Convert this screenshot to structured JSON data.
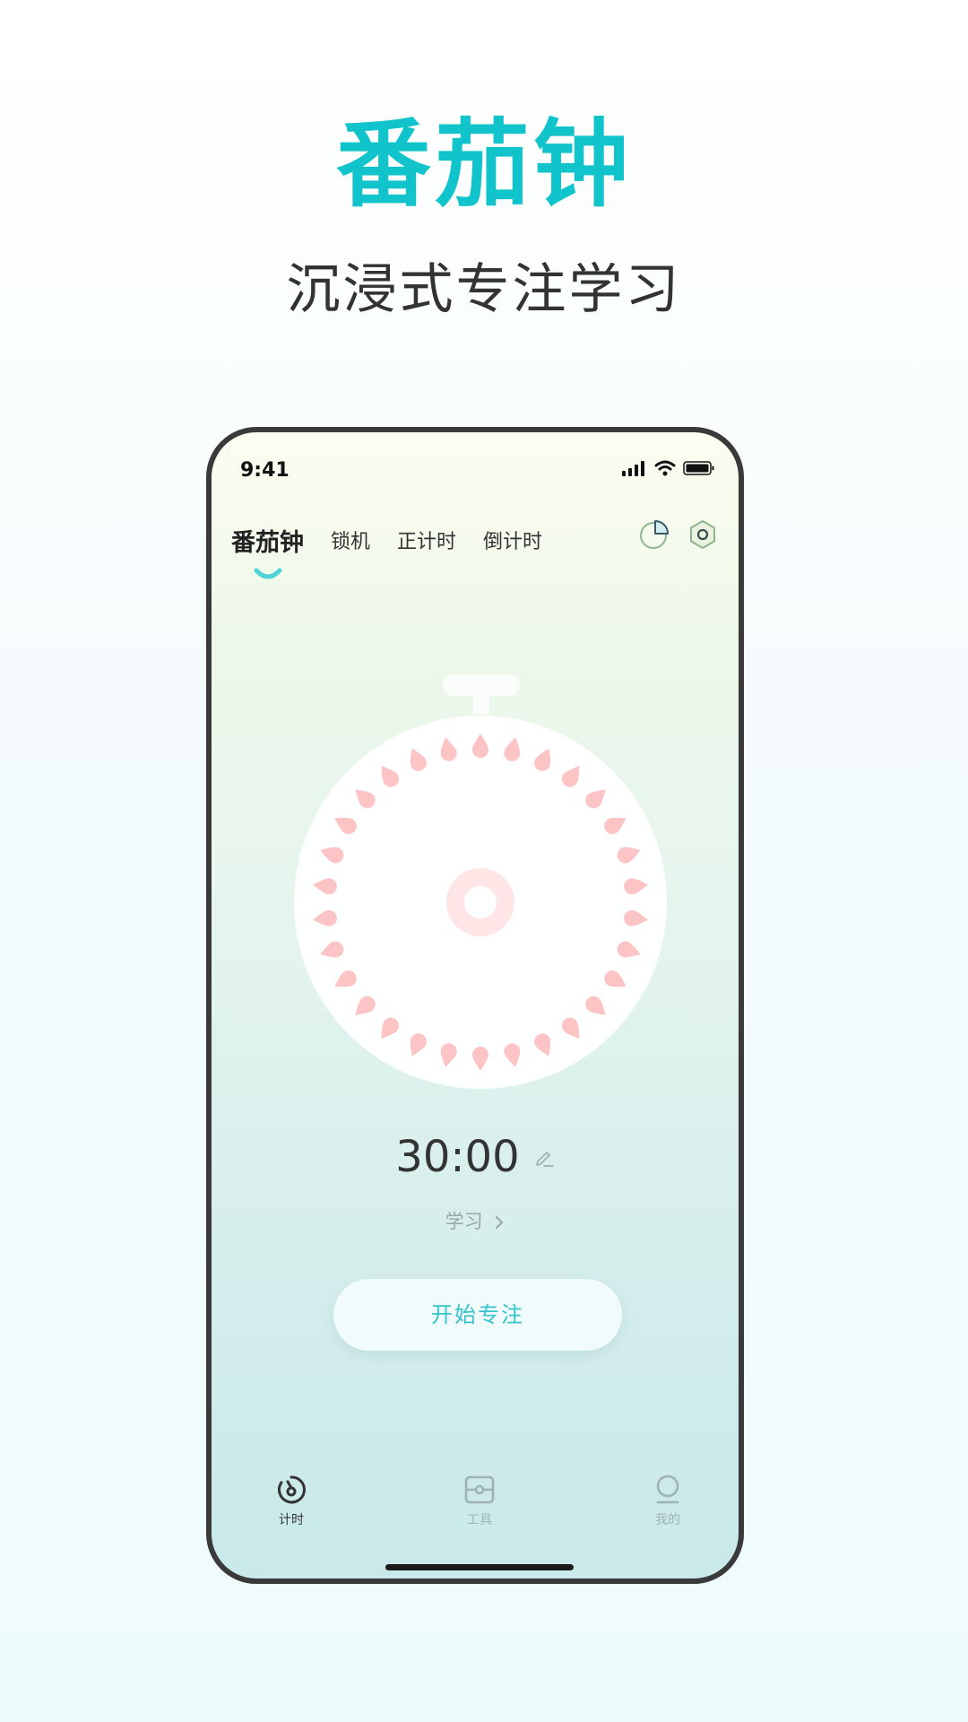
{
  "hero": {
    "title": "番茄钟",
    "subtitle": "沉浸式专注学习"
  },
  "status_bar": {
    "time": "9:41"
  },
  "tabs": [
    {
      "label": "番茄钟",
      "active": true
    },
    {
      "label": "锁机",
      "active": false
    },
    {
      "label": "正计时",
      "active": false
    },
    {
      "label": "倒计时",
      "active": false
    }
  ],
  "timer": {
    "time": "30:00",
    "category": "学习",
    "start_label": "开始专注",
    "tick_count": 30
  },
  "bottom_nav": [
    {
      "label": "计时",
      "icon": "timer-icon",
      "active": true
    },
    {
      "label": "工具",
      "icon": "toolbox-icon",
      "active": false
    },
    {
      "label": "我的",
      "icon": "profile-icon",
      "active": false
    }
  ],
  "colors": {
    "accent": "#11c4cc",
    "tick": "#fcc4c4",
    "center_ring": "#ffe6e6",
    "nav_active": "#333333",
    "nav_inactive": "#9fb2b6"
  }
}
